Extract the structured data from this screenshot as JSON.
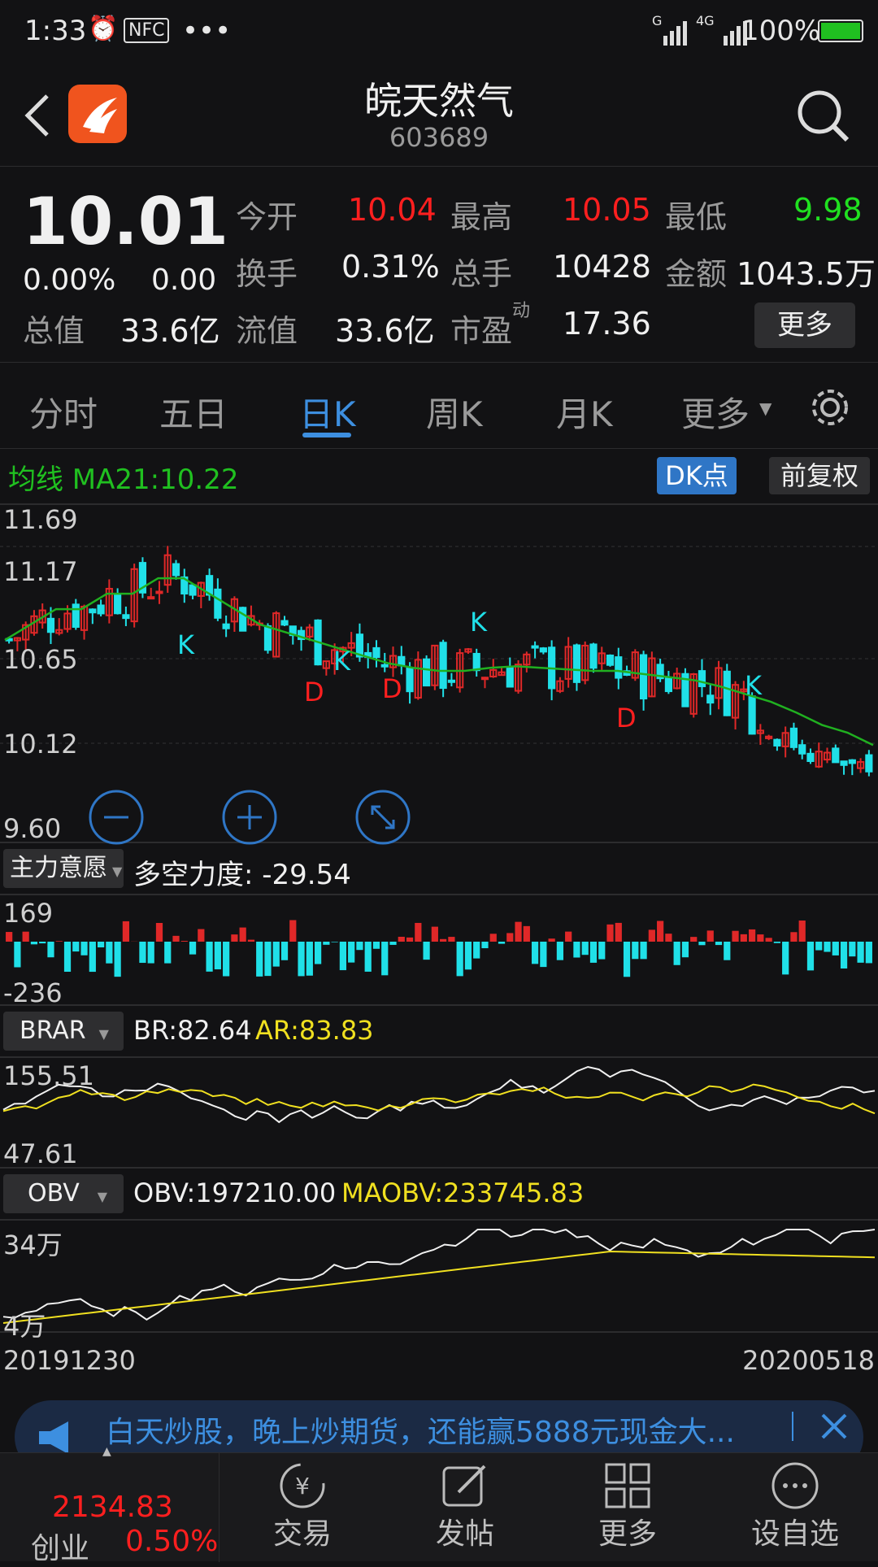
{
  "status": {
    "time": "1:33",
    "nfc": "NFC",
    "more": "•••",
    "net1": "G",
    "net2": "4G",
    "battery": "100%"
  },
  "header": {
    "name": "皖天然气",
    "code": "603689"
  },
  "quote": {
    "price": "10.01",
    "change_pct": "0.00%",
    "change": "0.00",
    "cap_label": "总值",
    "cap": "33.6亿",
    "open_label": "今开",
    "open": "10.04",
    "high_label": "最高",
    "high": "10.05",
    "low_label": "最低",
    "low": "9.98",
    "turnover_label": "换手",
    "turnover": "0.31%",
    "volume_label": "总手",
    "volume": "10428",
    "amount_label": "金额",
    "amount": "1043.5万",
    "float_label": "流值",
    "float": "33.6亿",
    "pe_label": "市盈",
    "pe_sup": "动",
    "pe": "17.36",
    "more": "更多"
  },
  "tabs": [
    "分时",
    "五日",
    "日K",
    "周K",
    "月K",
    "更多"
  ],
  "chart": {
    "ma_label": "均线 MA21:10.22",
    "dk_btn": "DK点",
    "fq_btn": "前复权",
    "price_ticks": [
      "11.69",
      "11.17",
      "10.65",
      "10.12",
      "9.60"
    ],
    "markers_k": [
      "K",
      "K",
      "K",
      "K"
    ],
    "markers_d": [
      "D",
      "D",
      "D"
    ],
    "ind1_select": "主力意愿",
    "ind1_value": "多空力度: -29.54",
    "ind1_ticks": [
      "169",
      "-236"
    ],
    "ind2_select": "BRAR",
    "ind2_br": "BR:82.64",
    "ind2_ar": "AR:83.83",
    "ind2_ticks": [
      "155.51",
      "47.61"
    ],
    "ind3_select": "OBV",
    "ind3_obv": "OBV:197210.00",
    "ind3_ma": "MAOBV:233745.83",
    "ind3_ticks": [
      "34万",
      "4万"
    ],
    "date_start": "20191230",
    "date_end": "20200518"
  },
  "chart_data": {
    "type": "line",
    "title": "",
    "ylim": [
      9.6,
      11.69
    ],
    "y_ticks": [
      11.69,
      11.17,
      10.65,
      10.12,
      9.6
    ],
    "x_range": [
      "20191230",
      "20200518"
    ],
    "series": [
      {
        "name": "MA21",
        "values": [
          10.9,
          11.0,
          11.1,
          11.1,
          11.2,
          11.2,
          11.3,
          11.3,
          11.2,
          11.1,
          11.0,
          10.95,
          10.9,
          10.85,
          10.8,
          10.75,
          10.72,
          10.7,
          10.7,
          10.72,
          10.73,
          10.72,
          10.71,
          10.7,
          10.7,
          10.68,
          10.66,
          10.64,
          10.6,
          10.55,
          10.5,
          10.43,
          10.35,
          10.3,
          10.22
        ]
      }
    ]
  },
  "banner": {
    "text": "白天炒股，晚上炒期货，还能赢5888元现金大..."
  },
  "bottom": {
    "index_value": "2134.83",
    "index_name": "创业",
    "index_pct": "0.50%",
    "nav": [
      "交易",
      "发帖",
      "更多",
      "设自选"
    ]
  }
}
